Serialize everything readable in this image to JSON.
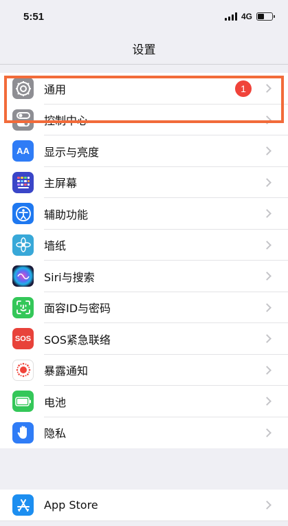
{
  "status": {
    "time": "5:51",
    "network": "4G",
    "battery_level": 0.45
  },
  "nav": {
    "title": "设置"
  },
  "groups": [
    {
      "items": [
        {
          "label": "通用",
          "icon": "gear-icon",
          "color": "#8e8e93",
          "badge": "1"
        },
        {
          "label": "控制中心",
          "icon": "toggle-icon",
          "color": "#8e8e93"
        },
        {
          "label": "显示与亮度",
          "icon": "text-size-icon",
          "color": "#2f7cf6",
          "icon_text": "AA"
        },
        {
          "label": "主屏幕",
          "icon": "home-grid-icon",
          "color": "#3a46c8"
        },
        {
          "label": "辅助功能",
          "icon": "accessibility-icon",
          "color": "#1f78f0"
        },
        {
          "label": "墙纸",
          "icon": "wallpaper-flower-icon",
          "color": "#38a8d8"
        },
        {
          "label": "Siri与搜索",
          "icon": "siri-icon",
          "color": "#2a2350"
        },
        {
          "label": "面容ID与密码",
          "icon": "face-id-icon",
          "color": "#34c759"
        },
        {
          "label": "SOS紧急联络",
          "icon": "sos-icon",
          "color": "#e8423a",
          "icon_text": "SOS"
        },
        {
          "label": "暴露通知",
          "icon": "exposure-notification-icon",
          "color": "#ffffff"
        },
        {
          "label": "电池",
          "icon": "battery-icon",
          "color": "#34c759"
        },
        {
          "label": "隐私",
          "icon": "hand-icon",
          "color": "#2f7cf6"
        }
      ]
    },
    {
      "items": [
        {
          "label": "App Store",
          "icon": "app-store-icon",
          "color": "#1c8ef0"
        }
      ]
    }
  ],
  "highlight_color": "#f26b3a"
}
